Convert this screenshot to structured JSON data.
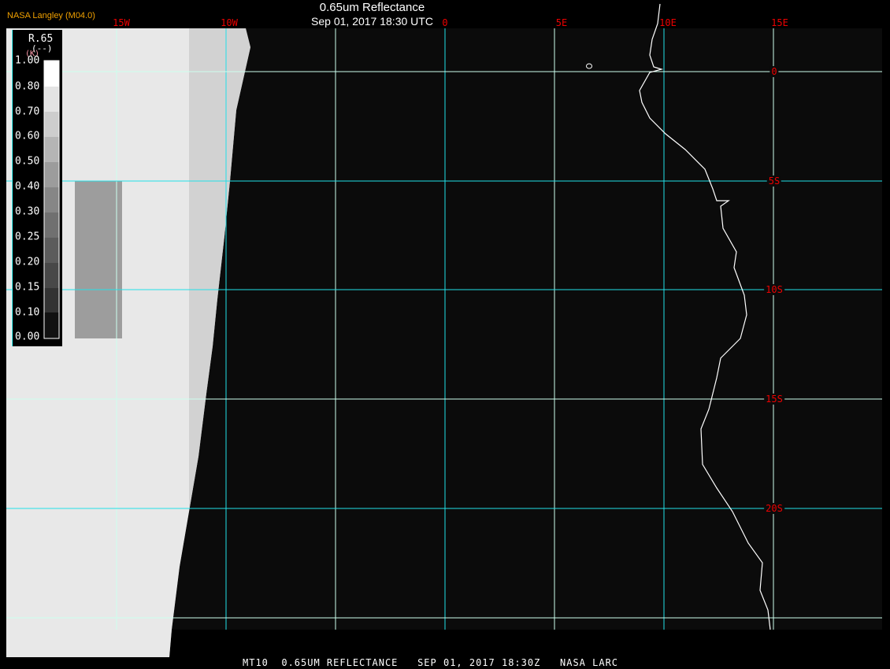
{
  "header": {
    "title": "0.65um Reflectance",
    "subtitle": "Sep 01, 2017 18:30 UTC",
    "brand": "NASA Langley (M04.0)"
  },
  "footer": {
    "text": "MT10  0.65UM REFLECTANCE   SEP 01, 2017 18:30Z   NASA LARC"
  },
  "longitudes": [
    "15W",
    "10W",
    "0",
    "5E",
    "10E",
    "15E"
  ],
  "latitudes": [
    "0",
    "5S",
    "10S",
    "15S",
    "20S"
  ],
  "legend": {
    "title": "R.65",
    "units": "(--)",
    "units2": "(K)",
    "values": [
      "1.00",
      "0.80",
      "0.70",
      "0.60",
      "0.50",
      "0.40",
      "0.30",
      "0.25",
      "0.20",
      "0.15",
      "0.10",
      "0.00"
    ]
  },
  "colors": {
    "grid": "#22e0e8",
    "label": "#ee0000",
    "brand": "#f0a000"
  }
}
